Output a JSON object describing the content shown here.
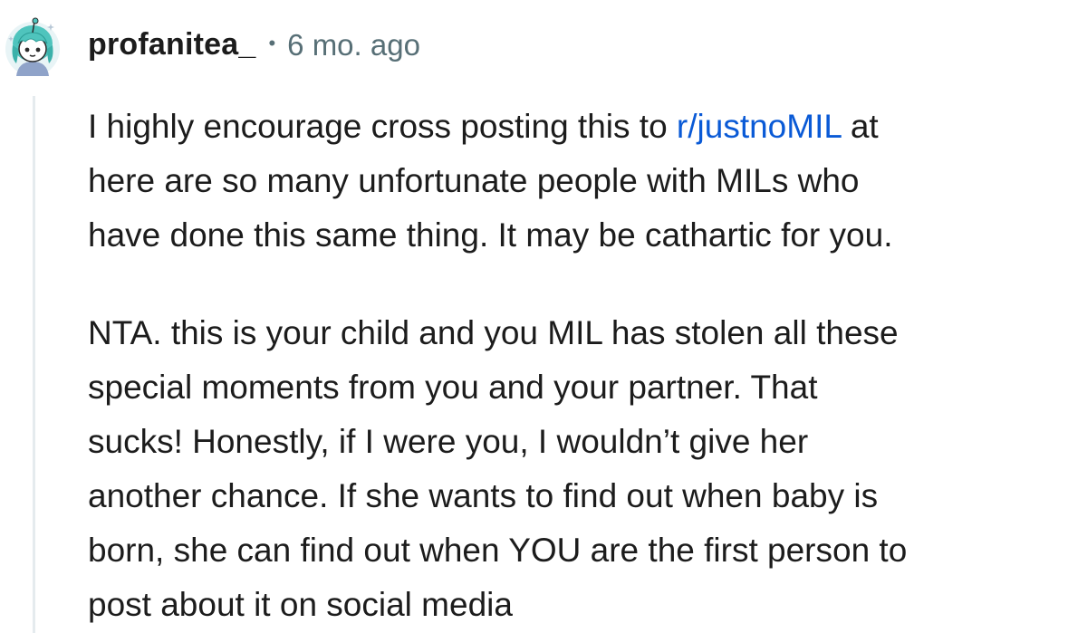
{
  "comment": {
    "author": "profanitea_",
    "separator": "•",
    "timestamp": "6 mo. ago",
    "avatar_icon": "snoo-avatar-teal-hair-icon",
    "link_color": "#0a5ad6",
    "paragraph1": {
      "line1_before": "I highly encourage cross posting this to ",
      "line1_link": "r/justnoMIL",
      "line1_after": " at",
      "line2": "here are so many unfortunate people with MILs who",
      "line3": "have done this same thing. It may be cathartic for you."
    },
    "paragraph2": {
      "line1": "NTA. this is your child and you MIL has stolen all these",
      "line2": "special moments from you and your partner. That",
      "line3": "sucks! Honestly, if I were you, I wouldn’t give her",
      "line4": "another chance. If she wants to find out when baby is",
      "line5": "born, she can find out when YOU are the first person to",
      "line6": "post about it on social media"
    }
  }
}
